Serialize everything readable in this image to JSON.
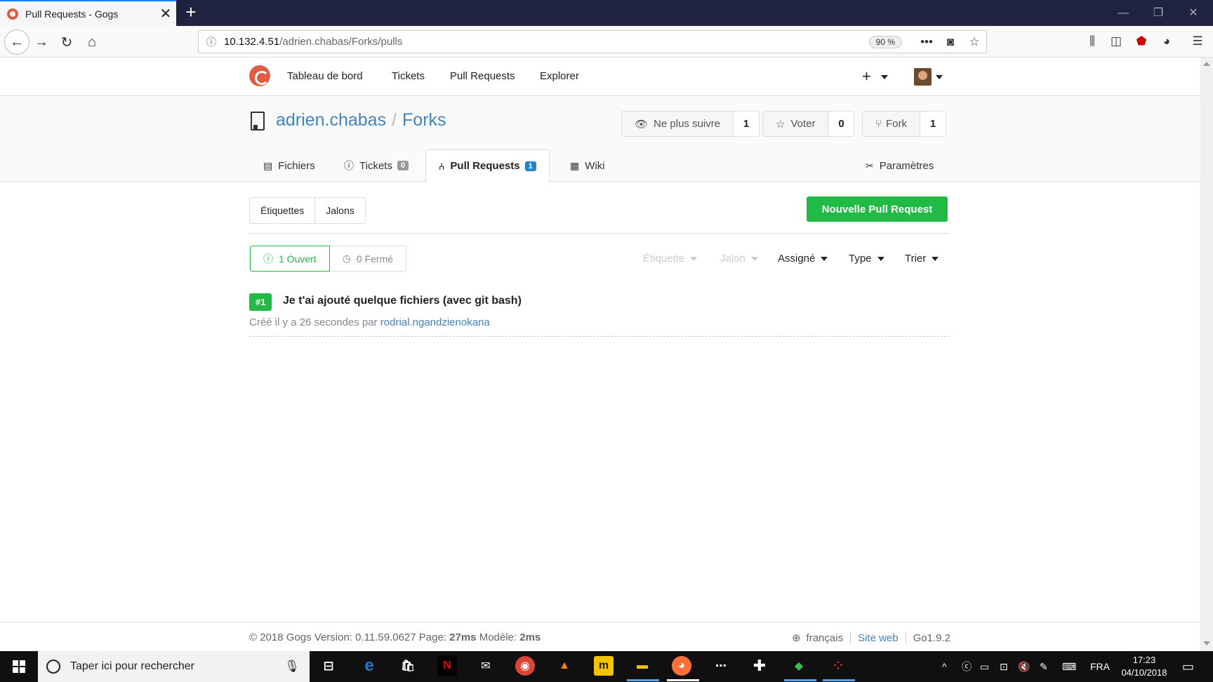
{
  "browser": {
    "tab_title": "Pull Requests - Gogs",
    "url_host": "10.132.4.51",
    "url_path": "/adrien.chabas/Forks/pulls",
    "zoom": "90 %"
  },
  "header": {
    "nav": [
      "Tableau de bord",
      "Tickets",
      "Pull Requests",
      "Explorer"
    ],
    "plus": "+"
  },
  "repo": {
    "owner": "adrien.chabas",
    "separator": "/",
    "name": "Forks",
    "watch_label": "Ne plus suivre",
    "watch_count": "1",
    "star_label": "Voter",
    "star_count": "0",
    "fork_label": "Fork",
    "fork_count": "1",
    "tabs": {
      "files": "Fichiers",
      "issues": "Tickets",
      "issues_count": "0",
      "pulls": "Pull Requests",
      "pulls_count": "1",
      "wiki": "Wiki",
      "settings": "Paramètres"
    }
  },
  "main": {
    "labels": "Étiquettes",
    "milestones": "Jalons",
    "new_pr": "Nouvelle Pull Request",
    "open": "1 Ouvert",
    "closed": "0 Fermé",
    "filters": {
      "label": "Étiquette",
      "milestone": "Jalon",
      "assignee": "Assigné",
      "type": "Type",
      "sort": "Trier"
    },
    "pr": {
      "number": "#1",
      "title": "Je t'ai ajouté quelque fichiers (avec git bash)",
      "meta": "Créé il y a 26 secondes par",
      "author": "rodrial.ngandzienokana"
    }
  },
  "footer": {
    "copyright": "© 2018 Gogs Version: 0.11.59.0627 Page:",
    "page_time": "27ms",
    "template_label": "Modèle:",
    "template_time": "2ms",
    "language": "français",
    "website": "Site web",
    "go_version": "Go1.9.2"
  },
  "taskbar": {
    "search_placeholder": "Taper ici pour rechercher",
    "lang": "FRA",
    "time": "17:23",
    "date": "04/10/2018"
  },
  "colors": {
    "accent_green": "#21ba45",
    "link_blue": "#4183c4",
    "gogs_red": "#e05d44"
  }
}
